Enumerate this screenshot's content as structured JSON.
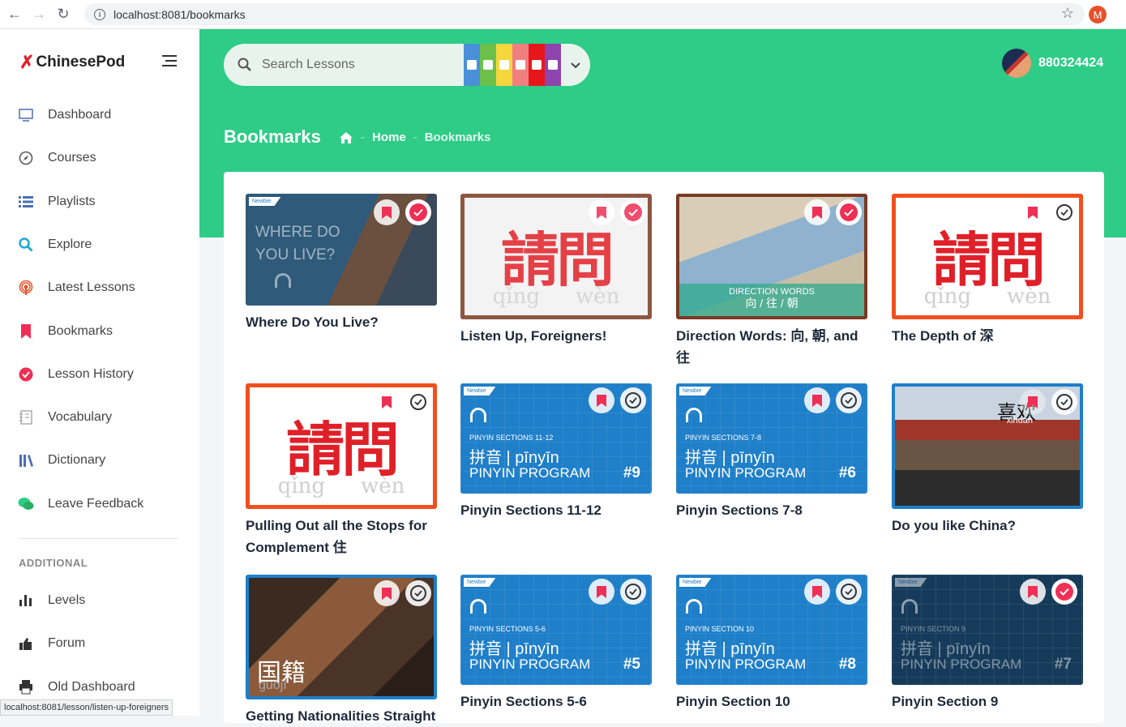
{
  "browser": {
    "url": "localhost:8081/bookmarks",
    "profile_initial": "M"
  },
  "sidebar": {
    "brand": "ChinesePod",
    "items": [
      {
        "label": "Dashboard",
        "icon": "monitor-icon"
      },
      {
        "label": "Courses",
        "icon": "compass-icon"
      },
      {
        "label": "Playlists",
        "icon": "list-icon"
      },
      {
        "label": "Explore",
        "icon": "search-icon"
      },
      {
        "label": "Latest Lessons",
        "icon": "podcast-icon"
      },
      {
        "label": "Bookmarks",
        "icon": "bookmark-icon"
      },
      {
        "label": "Lesson History",
        "icon": "check-circle-icon"
      },
      {
        "label": "Vocabulary",
        "icon": "notebook-icon"
      },
      {
        "label": "Dictionary",
        "icon": "books-icon"
      },
      {
        "label": "Leave Feedback",
        "icon": "chat-icon"
      }
    ],
    "section_title": "ADDITIONAL",
    "extra_items": [
      {
        "label": "Levels",
        "icon": "bar-chart-icon"
      },
      {
        "label": "Forum",
        "icon": "thumbs-up-icon"
      },
      {
        "label": "Old Dashboard",
        "icon": "printer-icon"
      }
    ]
  },
  "status_bar": "localhost:8081/lesson/listen-up-foreigners",
  "header": {
    "search_placeholder": "Search Lessons",
    "level_colors": [
      "#4a90d9",
      "#6cc04a",
      "#f5d63d",
      "#f08080",
      "#e8161b",
      "#8e44ad"
    ],
    "username": "880324424"
  },
  "page": {
    "title": "Bookmarks",
    "breadcrumb": [
      "Home",
      "Bookmarks"
    ]
  },
  "cards": [
    {
      "title": "Where Do You Live?",
      "thumb_text": "WHERE DO YOU LIVE?",
      "done": true
    },
    {
      "title": "Listen Up, Foreigners!",
      "chars": "請問",
      "pinyin": [
        "qǐng",
        "wèn"
      ],
      "done": true
    },
    {
      "title": "Direction Words: 向, 朝, and 往",
      "thumb_text": "DIRECTION WORDS",
      "thumb_sub": "向 / 往 / 朝",
      "done": true
    },
    {
      "title": "The Depth of 深",
      "chars": "請問",
      "pinyin": [
        "qǐng",
        "wèn"
      ],
      "done": false
    },
    {
      "title": "Pulling Out all the Stops for Complement 住",
      "chars": "請問",
      "pinyin": [
        "qǐng",
        "wèn"
      ],
      "done": false
    },
    {
      "title": "Pinyin Sections 11-12",
      "section": "PINYIN SECTIONS 11-12",
      "num": "#9",
      "done": false
    },
    {
      "title": "Pinyin Sections 7-8",
      "section": "PINYIN SECTIONS 7-8",
      "num": "#6",
      "done": false
    },
    {
      "title": "Do you like China?",
      "thumb_text": "喜欢",
      "thumb_sub": "xǐhuan",
      "done": false
    },
    {
      "title": "Getting Nationalities Straight",
      "thumb_text": "国籍",
      "thumb_sub": "guójí",
      "done": false
    },
    {
      "title": "Pinyin Sections 5-6",
      "section": "PINYIN SECTIONS 5-6",
      "num": "#5",
      "done": false
    },
    {
      "title": "Pinyin Section 10",
      "section": "PINYIN SECTION 10",
      "num": "#8",
      "done": false
    },
    {
      "title": "Pinyin Section 9",
      "section": "PINYIN SECTION 9",
      "num": "#7",
      "done": true
    }
  ],
  "pinyin_labels": {
    "cn": "拼音 | pīnyīn",
    "program": "PINYIN PROGRAM",
    "newbie": "Newbie"
  },
  "accent": "#ef2f55"
}
